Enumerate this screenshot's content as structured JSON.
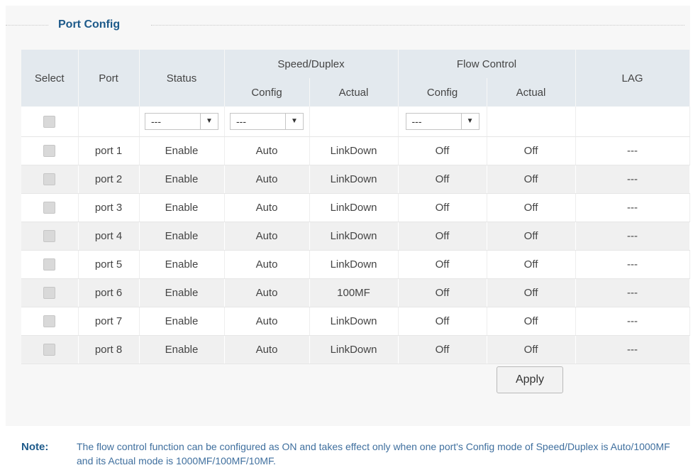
{
  "section": {
    "title": "Port Config"
  },
  "table": {
    "headers": {
      "select": "Select",
      "port": "Port",
      "status": "Status",
      "speed_duplex": "Speed/Duplex",
      "flow_control": "Flow Control",
      "lag": "LAG",
      "config": "Config",
      "actual": "Actual"
    },
    "filter": {
      "status_value": "---",
      "speed_value": "---",
      "flow_value": "---"
    },
    "rows": [
      {
        "port": "port 1",
        "status": "Enable",
        "speed_config": "Auto",
        "speed_actual": "LinkDown",
        "flow_config": "Off",
        "flow_actual": "Off",
        "lag": "---"
      },
      {
        "port": "port 2",
        "status": "Enable",
        "speed_config": "Auto",
        "speed_actual": "LinkDown",
        "flow_config": "Off",
        "flow_actual": "Off",
        "lag": "---"
      },
      {
        "port": "port 3",
        "status": "Enable",
        "speed_config": "Auto",
        "speed_actual": "LinkDown",
        "flow_config": "Off",
        "flow_actual": "Off",
        "lag": "---"
      },
      {
        "port": "port 4",
        "status": "Enable",
        "speed_config": "Auto",
        "speed_actual": "LinkDown",
        "flow_config": "Off",
        "flow_actual": "Off",
        "lag": "---"
      },
      {
        "port": "port 5",
        "status": "Enable",
        "speed_config": "Auto",
        "speed_actual": "LinkDown",
        "flow_config": "Off",
        "flow_actual": "Off",
        "lag": "---"
      },
      {
        "port": "port 6",
        "status": "Enable",
        "speed_config": "Auto",
        "speed_actual": "100MF",
        "flow_config": "Off",
        "flow_actual": "Off",
        "lag": "---"
      },
      {
        "port": "port 7",
        "status": "Enable",
        "speed_config": "Auto",
        "speed_actual": "LinkDown",
        "flow_config": "Off",
        "flow_actual": "Off",
        "lag": "---"
      },
      {
        "port": "port 8",
        "status": "Enable",
        "speed_config": "Auto",
        "speed_actual": "LinkDown",
        "flow_config": "Off",
        "flow_actual": "Off",
        "lag": "---"
      }
    ]
  },
  "actions": {
    "apply_label": "Apply"
  },
  "note": {
    "label": "Note:",
    "text": "The flow control function can be configured as ON and takes effect only when one port's Config mode of Speed/Duplex is Auto/1000MF and its Actual mode is 1000MF/100MF/10MF."
  },
  "colors": {
    "title": "#1d5a8a",
    "header_bg": "#e3e9ee",
    "note_text": "#3f6f9e"
  }
}
